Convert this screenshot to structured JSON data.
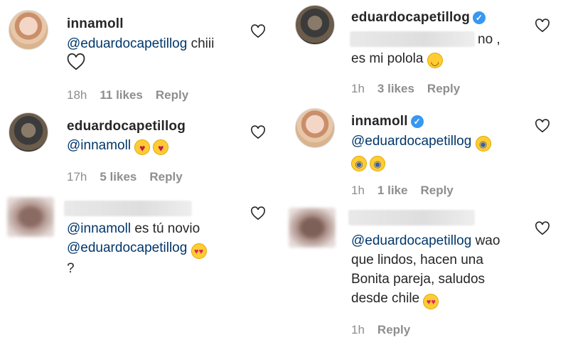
{
  "comments": [
    {
      "username": "innamoll",
      "verified": false,
      "text_mention": "@eduardocapetillog",
      "text": " chiii",
      "time": "18h",
      "likes": "11 likes",
      "reply": "Reply"
    },
    {
      "username": "eduardocapetillog",
      "verified": false,
      "text_mention": "@innamoll",
      "emojis": [
        "kissing-heart-emoji",
        "kissing-heart-emoji"
      ],
      "time": "17h",
      "likes": "5 likes",
      "reply": "Reply"
    },
    {
      "username": "",
      "text_mention": "@innamoll",
      "text": " es tú novio",
      "text_mention2": "@eduardocapetillog",
      "emojis": [
        "heart-eyes-emoji"
      ],
      "text_tail": "?"
    },
    {
      "username": "eduardocapetillog",
      "verified": true,
      "text_line1": "no ,",
      "text_line2": "es mi polola",
      "emojis": [
        "smirk-emoji"
      ],
      "time": "1h",
      "likes": "3 likes",
      "reply": "Reply"
    },
    {
      "username": "innamoll",
      "verified": true,
      "text_mention": "@eduardocapetillog",
      "emojis": [
        "scream-emoji",
        "scream-emoji",
        "scream-emoji"
      ],
      "time": "1h",
      "likes": "1 like",
      "reply": "Reply"
    },
    {
      "username": "",
      "text_mention": "@eduardocapetillog",
      "text_line1": " wao",
      "text_line2": "que lindos, hacen una",
      "text_line3": "Bonita pareja, saludos",
      "text_line4": "desde chile",
      "emojis": [
        "heart-eyes-emoji"
      ],
      "time": "1h",
      "reply": "Reply"
    }
  ],
  "icons": {
    "like": "heart-outline-icon",
    "verified": "verified-badge-icon"
  },
  "colors": {
    "text": "#262626",
    "mention": "#00376b",
    "meta": "#8e8e8e",
    "verified": "#3897f0"
  }
}
